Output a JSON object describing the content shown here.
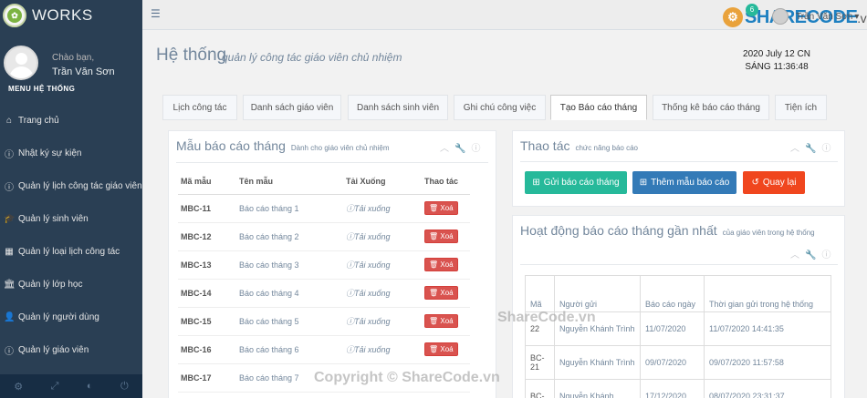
{
  "brand": {
    "name": "WORKS"
  },
  "profile": {
    "greeting": "Chào bạn,",
    "name": "Trần Văn Sơn",
    "menu_title": "MENU HỆ THỐNG"
  },
  "sidebar": {
    "items": [
      {
        "icon": "home-icon",
        "glyph": "⌂",
        "label": "Trang chủ"
      },
      {
        "icon": "info-icon",
        "glyph": "ⓘ",
        "label": "Nhật ký sự kiện"
      },
      {
        "icon": "info-icon",
        "glyph": "ⓘ",
        "label": "Quản lý lịch công tác giáo viên"
      },
      {
        "icon": "graduation-cap-icon",
        "glyph": "🎓",
        "label": "Quản lý sinh viên"
      },
      {
        "icon": "table-icon",
        "glyph": "▦",
        "label": "Quản lý loại lịch công tác"
      },
      {
        "icon": "institution-icon",
        "glyph": "🏛",
        "label": "Quản lý lớp học"
      },
      {
        "icon": "user-icon",
        "glyph": "👤",
        "label": "Quản lý người dùng"
      },
      {
        "icon": "info-icon",
        "glyph": "ⓘ",
        "label": "Quản lý giáo viên"
      }
    ],
    "footer_icons": [
      "settings-icon",
      "fullscreen-icon",
      "eye-slash-icon",
      "power-icon"
    ]
  },
  "topbar": {
    "logo_text": "SHARECODE",
    "logo_suffix": ".vn",
    "badge_count": "6",
    "user": "Trần Văn Sơn"
  },
  "header": {
    "title": "Hệ thống",
    "subtitle": "quản lý công tác giáo viên chủ nhiệm",
    "date": "2020 July 12 CN",
    "time": "SÁNG 11:36:48"
  },
  "tabs": [
    {
      "label": "Lịch công tác"
    },
    {
      "label": "Danh sách giáo viên"
    },
    {
      "label": "Danh sách sinh viên"
    },
    {
      "label": "Ghi chú công việc"
    },
    {
      "label": "Tạo Báo cáo tháng",
      "active": true
    },
    {
      "label": "Thống kê báo cáo tháng"
    },
    {
      "label": "Tiện ích"
    }
  ],
  "templates_panel": {
    "title": "Mẫu báo cáo tháng",
    "subtitle": "Dành cho giáo viên chủ nhiệm",
    "columns": [
      "Mã mẫu",
      "Tên mẫu",
      "Tải Xuống",
      "Thao tác"
    ],
    "rows": [
      {
        "code": "MBC-11",
        "name": "Báo cáo tháng 1",
        "download": "Tải xuống",
        "action": "Xoá"
      },
      {
        "code": "MBC-12",
        "name": "Báo cáo tháng 2",
        "download": "Tải xuống",
        "action": "Xoá"
      },
      {
        "code": "MBC-13",
        "name": "Báo cáo tháng 3",
        "download": "Tải xuống",
        "action": "Xoá"
      },
      {
        "code": "MBC-14",
        "name": "Báo cáo tháng 4",
        "download": "Tải xuống",
        "action": "Xoá"
      },
      {
        "code": "MBC-15",
        "name": "Báo cáo tháng 5",
        "download": "Tải xuống",
        "action": "Xoá"
      },
      {
        "code": "MBC-16",
        "name": "Báo cáo tháng 6",
        "download": "Tải xuống",
        "action": "Xoá"
      },
      {
        "code": "MBC-17",
        "name": "Báo cáo tháng 7",
        "download": "",
        "action": ""
      }
    ]
  },
  "actions_panel": {
    "title": "Thao tác",
    "subtitle": "chức năng báo cáo",
    "buttons": [
      {
        "label": "Gửi báo cáo tháng",
        "color": "#26b99a"
      },
      {
        "label": "Thêm mẫu báo cáo",
        "color": "#337ab7"
      },
      {
        "label": "Quay lại",
        "color": "#f0461e"
      }
    ]
  },
  "activity_panel": {
    "title": "Hoạt động báo cáo tháng gần nhất",
    "subtitle": "của giáo viên trong hệ thống",
    "columns": [
      "Mã",
      "Người gửi",
      "Báo cáo ngày",
      "Thời gian gửi trong hệ thống"
    ],
    "rows": [
      {
        "code": "22",
        "sender": "Nguyễn Khánh Trình",
        "date": "11/07/2020",
        "time": "11/07/2020 14:41:35"
      },
      {
        "code": "BC-21",
        "sender": "Nguyễn Khánh Trình",
        "date": "09/07/2020",
        "time": "09/07/2020 11:57:58"
      },
      {
        "code": "BC-",
        "sender": "Nguyễn Khánh",
        "date": "17/12/2020",
        "time": "08/07/2020 23:31:37"
      }
    ]
  },
  "watermarks": {
    "center": "ShareCode.vn",
    "bottom": "Copyright © ShareCode.vn"
  }
}
